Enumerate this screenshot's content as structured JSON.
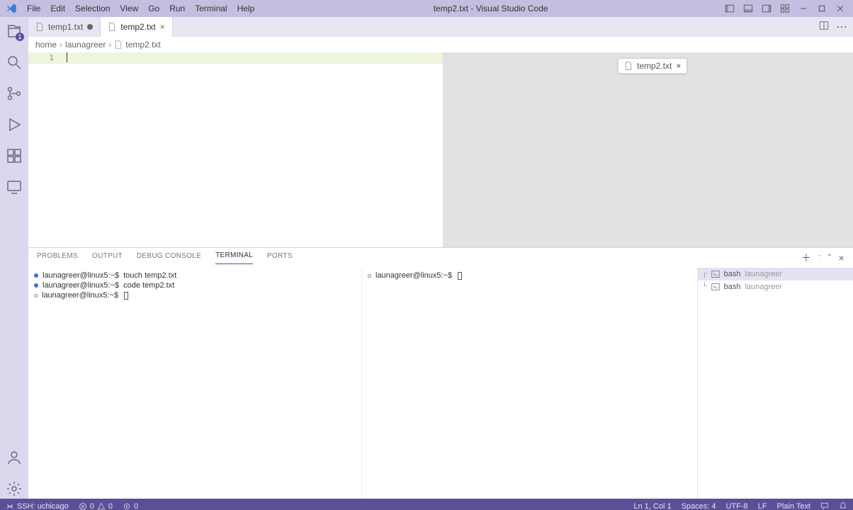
{
  "window": {
    "title": "temp2.txt - Visual Studio Code"
  },
  "menu": {
    "file": "File",
    "edit": "Edit",
    "selection": "Selection",
    "view": "View",
    "go": "Go",
    "run": "Run",
    "terminal": "Terminal",
    "help": "Help"
  },
  "activity": {
    "explorer_badge": "1"
  },
  "tabs": [
    {
      "label": "temp1.txt",
      "dirty": true,
      "active": false
    },
    {
      "label": "temp2.txt",
      "dirty": false,
      "active": true
    }
  ],
  "breadcrumbs": {
    "seg0": "home",
    "seg1": "launagreer",
    "seg2": "temp2.txt"
  },
  "editor": {
    "line1_no": "1"
  },
  "float_tab": {
    "label": "temp2.txt"
  },
  "panel": {
    "tabs": {
      "problems": "PROBLEMS",
      "output": "OUTPUT",
      "debug": "DEBUG CONSOLE",
      "terminal": "TERMINAL",
      "ports": "PORTS"
    }
  },
  "terminal": {
    "left": [
      {
        "bullet": "blue",
        "prompt": "launagreer@linux5:~$",
        "cmd": "touch temp2.txt"
      },
      {
        "bullet": "blue",
        "prompt": "launagreer@linux5:~$",
        "cmd": "code temp2.txt"
      },
      {
        "bullet": "hollow",
        "prompt": "launagreer@linux5:~$",
        "cmd": ""
      }
    ],
    "mid": [
      {
        "bullet": "hollow",
        "prompt": "launagreer@linux5:~$",
        "cmd": ""
      }
    ],
    "list": [
      {
        "tree": "┌",
        "shell": "bash",
        "cwd": "launagreer",
        "active": true
      },
      {
        "tree": "└",
        "shell": "bash",
        "cwd": "launagreer",
        "active": false
      }
    ]
  },
  "status": {
    "remote": "SSH: uchicago",
    "err": "0",
    "warn": "0",
    "ports": "0",
    "pos": "Ln 1, Col 1",
    "spaces": "Spaces: 4",
    "enc": "UTF-8",
    "eol": "LF",
    "lang": "Plain Text"
  }
}
